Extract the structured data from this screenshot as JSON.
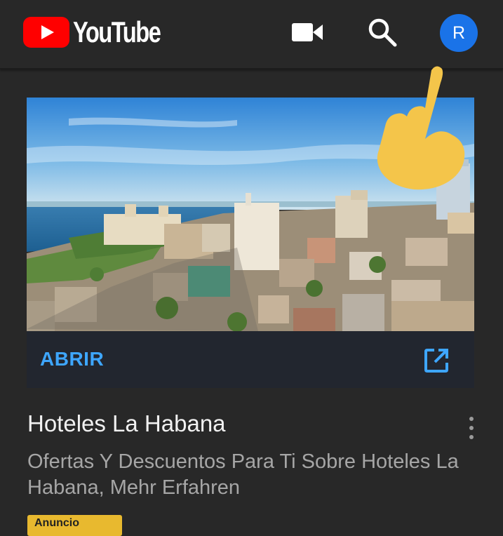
{
  "header": {
    "app_name": "YouTube",
    "avatar_initial": "R",
    "icons": [
      "youtube-logo-icon",
      "video-camera-icon",
      "search-icon"
    ],
    "accent_color": "#ff0000",
    "avatar_color": "#1a73e8"
  },
  "ad": {
    "open_label": "ABRIR",
    "open_icon": "external-link-icon",
    "title": "Hoteles La Habana",
    "description": "Ofertas Y Descuentos Para Ti Sobre Hoteles La Habana, Mehr Erfahren",
    "badge": "Anuncio",
    "link_color": "#3ea6ff",
    "badge_color": "#e8b92f"
  },
  "overlay": {
    "icon": "pointing-hand-icon"
  }
}
